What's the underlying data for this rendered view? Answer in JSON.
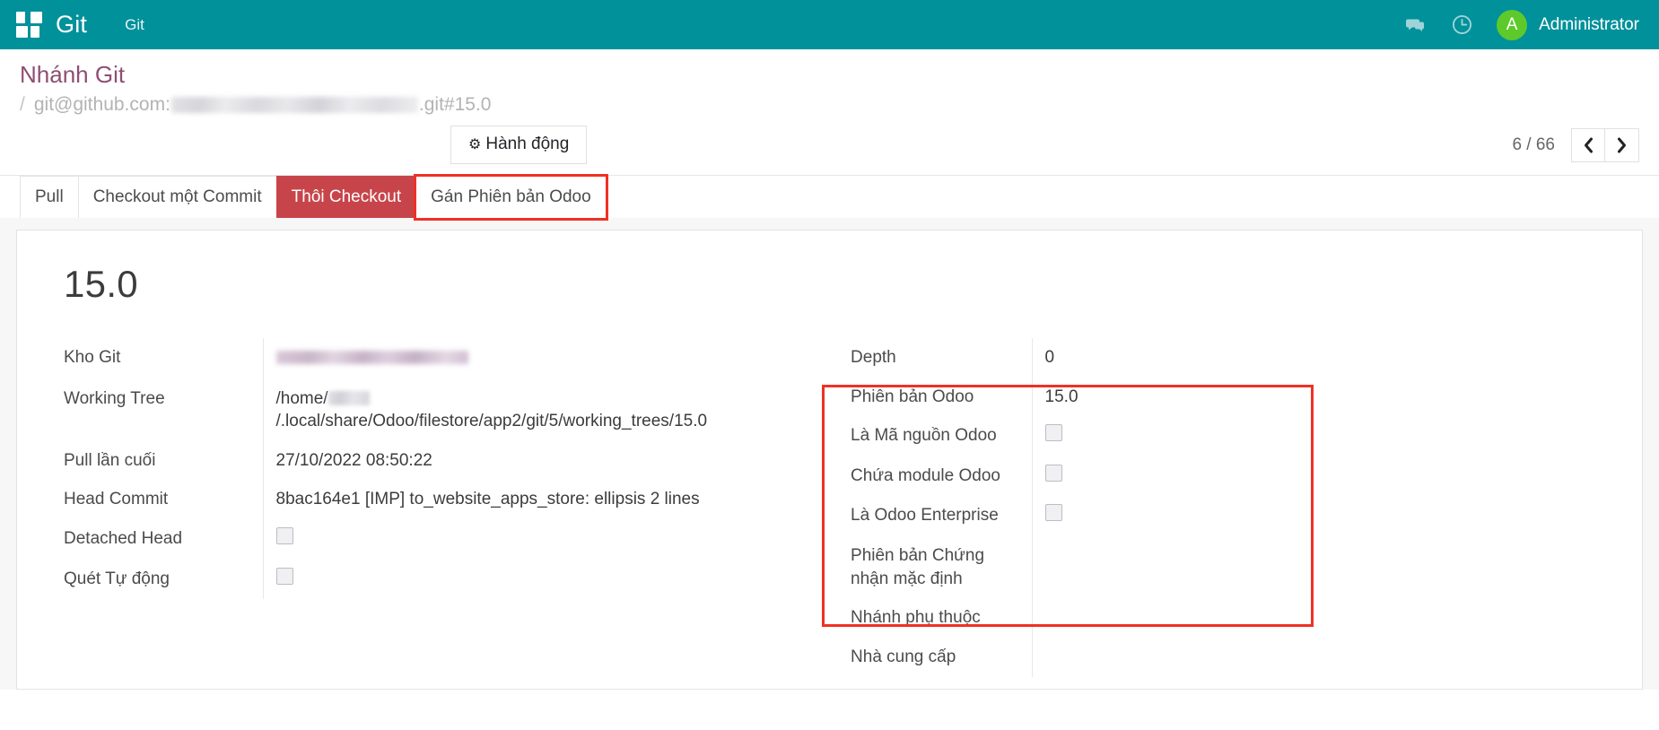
{
  "navbar": {
    "apps_icon": "apps-grid-icon",
    "brand": "Git",
    "menu": "Git",
    "messages_icon": "chat-bubble-icon",
    "activities_icon": "clock-icon",
    "avatar_letter": "A",
    "user_name": "Administrator",
    "brand_color": "#00919b",
    "avatar_color": "#5dc92b"
  },
  "control_panel": {
    "breadcrumb_title": "Nhánh Git",
    "breadcrumb_separator": "/",
    "breadcrumb_prefix": "git@github.com:",
    "breadcrumb_suffix": ".git#15.0",
    "action_button": "Hành động",
    "action_icon": "gear-icon",
    "pager_count": "6 / 66",
    "prev_icon": "‹",
    "next_icon": "›"
  },
  "stat_buttons": [
    {
      "label": "Pull",
      "style": "default"
    },
    {
      "label": "Checkout một Commit",
      "style": "default"
    },
    {
      "label": "Thôi Checkout",
      "style": "danger"
    },
    {
      "label": "Gán Phiên bản Odoo",
      "style": "highlighted"
    }
  ],
  "form": {
    "title": "15.0",
    "left_fields": [
      {
        "label": "Kho Git",
        "value": "",
        "type": "blurred-link"
      },
      {
        "label": "Working Tree",
        "value": "/home/",
        "value_suffix": "/.local/share/Odoo/filestore/app2/git/5/working_trees/15.0",
        "type": "blurred-path"
      },
      {
        "label": "Pull lần cuối",
        "value": "27/10/2022 08:50:22",
        "type": "text"
      },
      {
        "label": "Head Commit",
        "value": "8bac164e1 [IMP] to_website_apps_store: ellipsis 2 lines",
        "type": "text"
      },
      {
        "label": "Detached Head",
        "value": "",
        "type": "checkbox",
        "checked": false
      },
      {
        "label": "Quét Tự động",
        "value": "",
        "type": "checkbox",
        "checked": false
      }
    ],
    "right_fields": [
      {
        "label": "Depth",
        "value": "0",
        "type": "text"
      },
      {
        "label": "Phiên bản Odoo",
        "value": "15.0",
        "type": "text"
      },
      {
        "label": "Là Mã nguồn Odoo",
        "value": "",
        "type": "checkbox",
        "checked": false
      },
      {
        "label": "Chứa module Odoo",
        "value": "",
        "type": "checkbox",
        "checked": false
      },
      {
        "label": "Là Odoo Enterprise",
        "value": "",
        "type": "checkbox",
        "checked": false
      },
      {
        "label": "Phiên bản Chứng nhận mặc định",
        "value": "",
        "type": "text"
      },
      {
        "label": "Nhánh phụ thuộc",
        "value": "",
        "type": "text"
      },
      {
        "label": "Nhà cung cấp",
        "value": "",
        "type": "text"
      }
    ]
  },
  "annotations": {
    "highlight_color": "#ef3124",
    "highlighted_tab": "Gán Phiên bản Odoo",
    "highlighted_group_from": "Phiên bản Odoo",
    "highlighted_group_to": "Nhánh phụ thuộc"
  }
}
